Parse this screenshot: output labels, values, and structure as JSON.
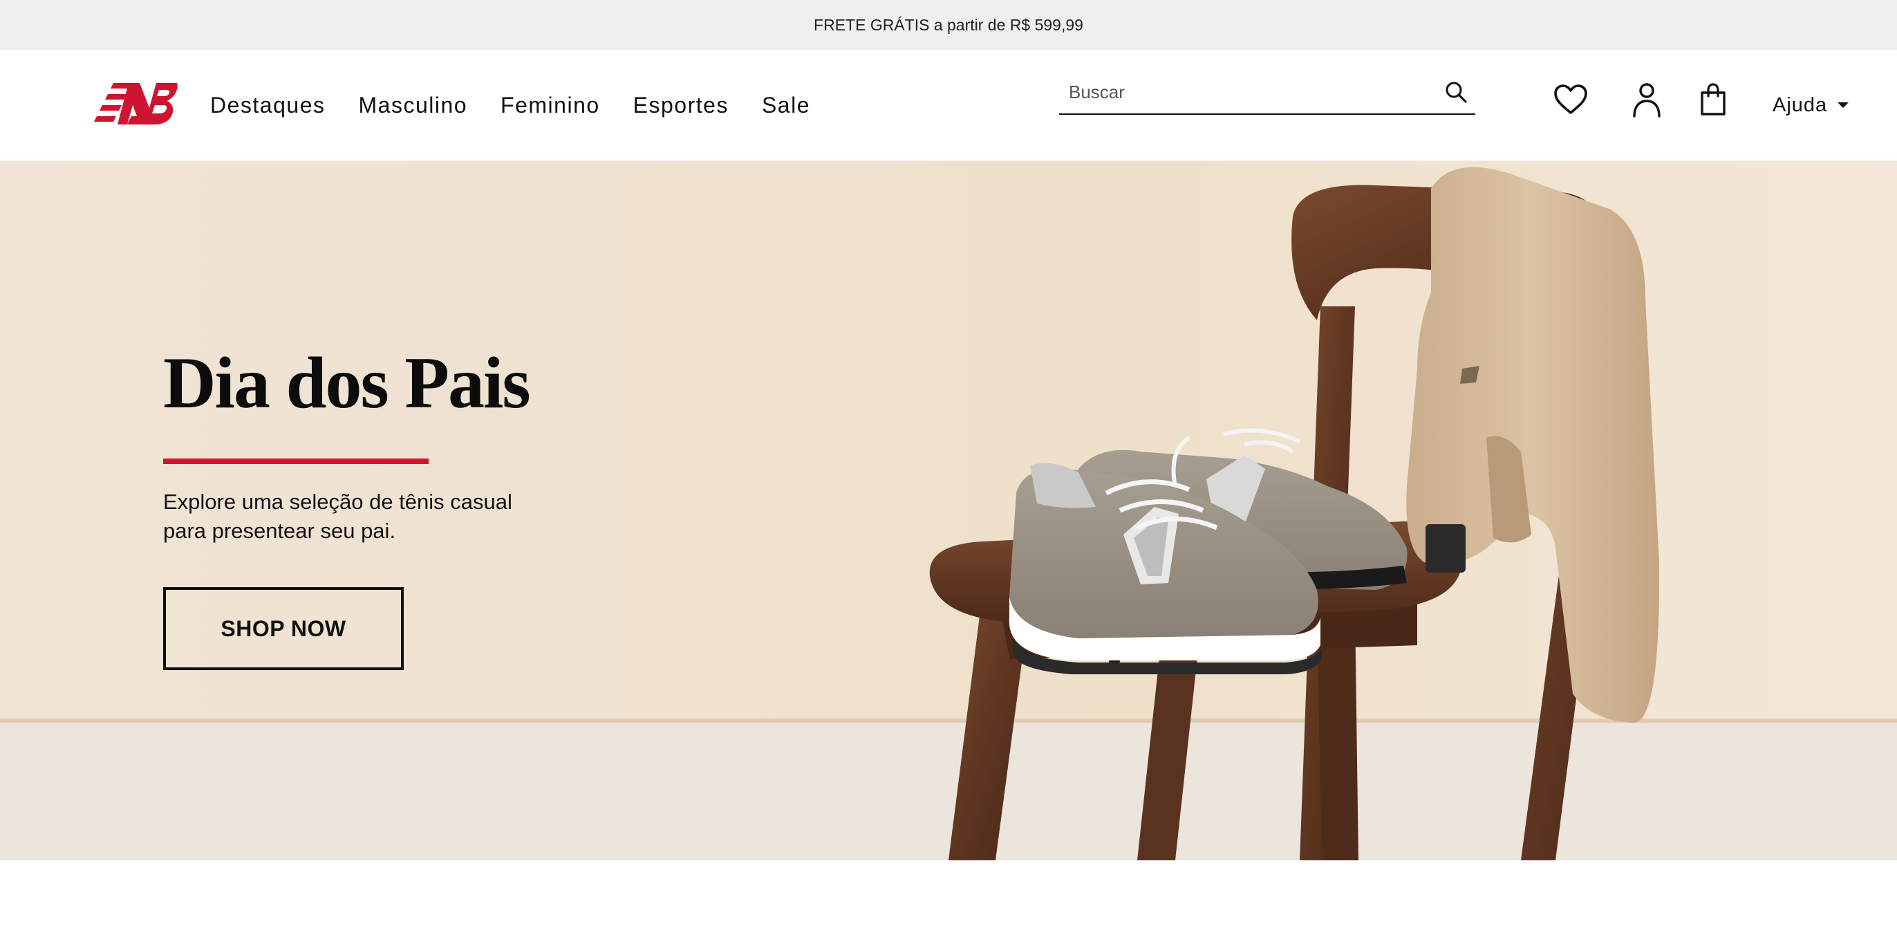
{
  "promo": {
    "text": "FRETE GRÁTIS a partir de R$ 599,99"
  },
  "brand": {
    "logo_text": "NB",
    "accent_color": "#cf1431"
  },
  "nav": {
    "items": [
      {
        "label": "Destaques"
      },
      {
        "label": "Masculino"
      },
      {
        "label": "Feminino"
      },
      {
        "label": "Esportes"
      },
      {
        "label": "Sale"
      }
    ]
  },
  "search": {
    "placeholder": "Buscar",
    "icon": "search-icon"
  },
  "actions": {
    "wishlist_icon": "heart-icon",
    "account_icon": "user-icon",
    "cart_icon": "shopping-bag-icon",
    "help_label": "Ajuda"
  },
  "hero": {
    "title": "Dia dos Pais",
    "subtitle": "Explore uma seleção de tênis casual para presentear seu pai.",
    "cta_label": "SHOP NOW"
  }
}
